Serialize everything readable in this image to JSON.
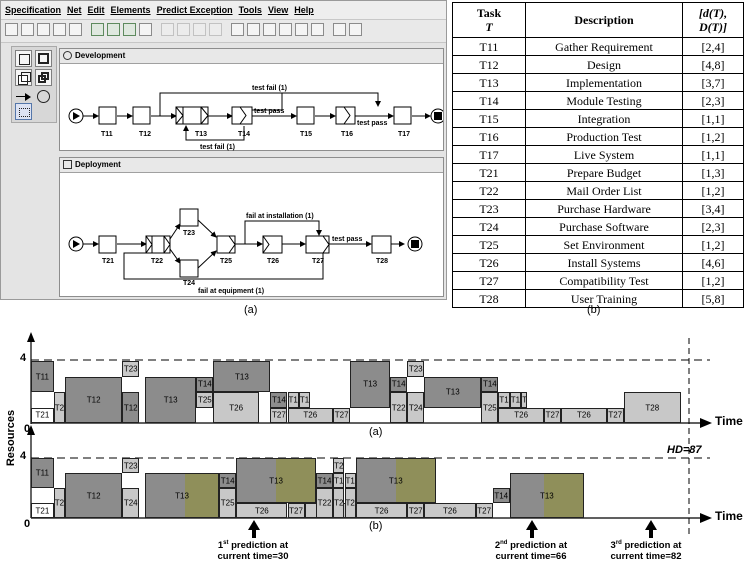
{
  "app": {
    "menus": [
      "Specification",
      "Net",
      "Edit",
      "Elements",
      "Predict Exception",
      "Tools",
      "View",
      "Help"
    ],
    "toolbar_icons": [
      "new-icon",
      "open-icon",
      "save-icon",
      "saveas-icon",
      "print-icon",
      "check-icon",
      "check-all-icon",
      "export-icon",
      "analyze-icon",
      "compare-icon",
      "redo-icon",
      "undo-icon",
      "delete-icon",
      "align-left-icon",
      "align-center-icon",
      "align-right-icon",
      "align-top-icon",
      "align-middle-icon",
      "align-bottom-icon",
      "zoom-icon",
      "fit-icon"
    ],
    "palette": [
      "atomic-task-icon",
      "composite-task-icon",
      "multi-task-icon",
      "composite-multi-task-icon",
      "flow-arrow-icon",
      "condition-icon",
      "marquee-icon"
    ],
    "panels": {
      "development": {
        "title": "Development",
        "tasks": [
          "T11",
          "T12",
          "T13",
          "T14",
          "T15",
          "T16",
          "T17"
        ],
        "edges": [
          "test fail (1)",
          "test pass",
          "test pass",
          "test fail (1)"
        ]
      },
      "deployment": {
        "title": "Deployment",
        "tasks": [
          "T21",
          "T22",
          "T23",
          "T24",
          "T25",
          "T26",
          "T27",
          "T28"
        ],
        "edges": [
          "fail at installation (1)",
          "test pass",
          "fail at equipment (1)"
        ]
      }
    }
  },
  "captions": {
    "a_top": "(a)",
    "b_top": "(b)",
    "a_chart": "(a)",
    "b_chart": "(b)"
  },
  "table": {
    "headers": {
      "task_lines": [
        "Task",
        "T"
      ],
      "description": "Description",
      "interval_lines": [
        "[d(T),",
        "D(T)]"
      ]
    },
    "rows": [
      {
        "task": "T11",
        "description": "Gather Requirement",
        "interval": "[2,4]"
      },
      {
        "task": "T12",
        "description": "Design",
        "interval": "[4,8]"
      },
      {
        "task": "T13",
        "description": "Implementation",
        "interval": "[3,7]"
      },
      {
        "task": "T14",
        "description": "Module Testing",
        "interval": "[2,3]"
      },
      {
        "task": "T15",
        "description": "Integration",
        "interval": "[1,1]"
      },
      {
        "task": "T16",
        "description": "Production Test",
        "interval": "[1,2]"
      },
      {
        "task": "T17",
        "description": "Live System",
        "interval": "[1,1]"
      },
      {
        "task": "T21",
        "description": "Prepare Budget",
        "interval": "[1,3]"
      },
      {
        "task": "T22",
        "description": "Mail Order List",
        "interval": "[1,2]"
      },
      {
        "task": "T23",
        "description": "Purchase Hardware",
        "interval": "[3,4]"
      },
      {
        "task": "T24",
        "description": "Purchase Software",
        "interval": "[2,3]"
      },
      {
        "task": "T25",
        "description": "Set Environment",
        "interval": "[1,2]"
      },
      {
        "task": "T26",
        "description": "Install Systems",
        "interval": "[4,6]"
      },
      {
        "task": "T27",
        "description": "Compatibility Test",
        "interval": "[1,2]"
      },
      {
        "task": "T28",
        "description": "User Training",
        "interval": "[5,8]"
      }
    ]
  },
  "chart": {
    "ylabel": "Resources",
    "xlabel": "Time",
    "y_tick_top": "4",
    "y_tick_zero": "0",
    "hd_label": "HD=87",
    "predictions": [
      {
        "ord": "1",
        "sup": "st",
        "text": " prediction at",
        "line2": "current time=30"
      },
      {
        "ord": "2",
        "sup": "nd",
        "text": " prediction at",
        "line2": "current time=66"
      },
      {
        "ord": "3",
        "sup": "rd",
        "text": " prediction at",
        "line2": "current time=82"
      }
    ]
  },
  "chart_data": [
    {
      "type": "gantt",
      "title": "(a)",
      "xlabel": "Time",
      "ylabel": "Resources",
      "ylim": [
        0,
        4
      ],
      "blocks": [
        {
          "task": "T11",
          "start": 0,
          "end": 4,
          "resources": [
            2,
            4
          ]
        },
        {
          "task": "T21",
          "start": 0,
          "end": 4,
          "resources": [
            0,
            1
          ]
        },
        {
          "task": "T22",
          "start": 4,
          "end": 6,
          "resources": [
            0,
            2
          ]
        },
        {
          "task": "T12",
          "start": 6,
          "end": 16,
          "resources": [
            0,
            3
          ]
        },
        {
          "task": "T23",
          "start": 16,
          "end": 19,
          "resources": [
            3,
            4
          ]
        },
        {
          "task": "T12",
          "start": 16,
          "end": 19,
          "resources": [
            0,
            2
          ]
        },
        {
          "task": "T13",
          "start": 20,
          "end": 29,
          "resources": [
            0,
            3
          ]
        },
        {
          "task": "T14",
          "start": 29,
          "end": 32,
          "resources": [
            2,
            3
          ]
        },
        {
          "task": "T25",
          "start": 29,
          "end": 32,
          "resources": [
            1,
            2
          ]
        },
        {
          "task": "T13",
          "start": 32,
          "end": 42,
          "resources": [
            2,
            4
          ]
        },
        {
          "task": "T26",
          "start": 32,
          "end": 40,
          "resources": [
            0,
            2
          ]
        },
        {
          "task": "T14",
          "start": 42,
          "end": 45,
          "resources": [
            1,
            2
          ]
        },
        {
          "task": "T15",
          "start": 45,
          "end": 47,
          "resources": [
            1,
            2
          ]
        },
        {
          "task": "T16",
          "start": 47,
          "end": 49,
          "resources": [
            1,
            2
          ]
        },
        {
          "task": "T27",
          "start": 42,
          "end": 45,
          "resources": [
            0,
            1
          ]
        },
        {
          "task": "T26",
          "start": 45,
          "end": 53,
          "resources": [
            0,
            1
          ]
        },
        {
          "task": "T27",
          "start": 53,
          "end": 56,
          "resources": [
            0,
            1
          ]
        },
        {
          "task": "T13",
          "start": 56,
          "end": 63,
          "resources": [
            1,
            4
          ]
        },
        {
          "task": "T14",
          "start": 63,
          "end": 66,
          "resources": [
            2,
            3
          ]
        },
        {
          "task": "T22",
          "start": 63,
          "end": 66,
          "resources": [
            0,
            2
          ]
        },
        {
          "task": "T23",
          "start": 66,
          "end": 69,
          "resources": [
            3,
            4
          ]
        },
        {
          "task": "T24",
          "start": 66,
          "end": 69,
          "resources": [
            0,
            2
          ]
        },
        {
          "task": "T13",
          "start": 69,
          "end": 79,
          "resources": [
            1,
            3
          ]
        },
        {
          "task": "T14",
          "start": 79,
          "end": 82,
          "resources": [
            2,
            3
          ]
        },
        {
          "task": "T25",
          "start": 79,
          "end": 82,
          "resources": [
            0,
            2
          ]
        },
        {
          "task": "T15",
          "start": 82,
          "end": 84,
          "resources": [
            1,
            2
          ]
        },
        {
          "task": "T16",
          "start": 84,
          "end": 86,
          "resources": [
            1,
            2
          ]
        },
        {
          "task": "T17",
          "start": 86,
          "end": 87,
          "resources": [
            1,
            2
          ]
        },
        {
          "task": "T26",
          "start": 82,
          "end": 90,
          "resources": [
            0,
            1
          ]
        },
        {
          "task": "T27",
          "start": 90,
          "end": 93,
          "resources": [
            0,
            1
          ]
        },
        {
          "task": "T26",
          "start": 93,
          "end": 101,
          "resources": [
            0,
            1
          ]
        },
        {
          "task": "T27",
          "start": 101,
          "end": 104,
          "resources": [
            0,
            1
          ]
        },
        {
          "task": "T28",
          "start": 104,
          "end": 114,
          "resources": [
            0,
            2
          ]
        }
      ]
    },
    {
      "type": "gantt",
      "title": "(b)",
      "xlabel": "Time",
      "ylabel": "Resources",
      "ylim": [
        0,
        4
      ],
      "deadline_label": "HD=87",
      "blocks": [
        {
          "task": "T11",
          "start": 0,
          "end": 4,
          "resources": [
            2,
            4
          ]
        },
        {
          "task": "T21",
          "start": 0,
          "end": 4,
          "resources": [
            0,
            1
          ]
        },
        {
          "task": "T22",
          "start": 4,
          "end": 6,
          "resources": [
            0,
            2
          ]
        },
        {
          "task": "T12",
          "start": 6,
          "end": 16,
          "resources": [
            0,
            3
          ]
        },
        {
          "task": "T23",
          "start": 16,
          "end": 19,
          "resources": [
            3,
            4
          ]
        },
        {
          "task": "T24",
          "start": 16,
          "end": 19,
          "resources": [
            0,
            2
          ]
        },
        {
          "task": "T13",
          "start": 20,
          "end": 33,
          "resources": [
            0,
            3
          ],
          "predicted_from": 27
        },
        {
          "task": "T14",
          "start": 33,
          "end": 36,
          "resources": [
            2,
            3
          ]
        },
        {
          "task": "T25",
          "start": 33,
          "end": 36,
          "resources": [
            0,
            2
          ]
        },
        {
          "task": "T13",
          "start": 36,
          "end": 50,
          "resources": [
            1,
            4
          ],
          "predicted_from": 43
        },
        {
          "task": "T26",
          "start": 36,
          "end": 45,
          "resources": [
            0,
            1
          ]
        },
        {
          "task": "T27",
          "start": 45,
          "end": 48,
          "resources": [
            0,
            1
          ]
        },
        {
          "task": "T26",
          "start": 48,
          "end": 57,
          "resources": [
            0,
            1
          ]
        },
        {
          "task": "T27",
          "start": 57,
          "end": 60,
          "resources": [
            0,
            1
          ]
        },
        {
          "task": "T14",
          "start": 50,
          "end": 53,
          "resources": [
            2,
            3
          ]
        },
        {
          "task": "T22",
          "start": 50,
          "end": 53,
          "resources": [
            0,
            2
          ]
        },
        {
          "task": "T23",
          "start": 53,
          "end": 55,
          "resources": [
            3,
            4
          ]
        },
        {
          "task": "T15",
          "start": 53,
          "end": 55,
          "resources": [
            2,
            3
          ]
        },
        {
          "task": "T24",
          "start": 53,
          "end": 55,
          "resources": [
            0,
            2
          ]
        },
        {
          "task": "T16",
          "start": 55,
          "end": 57,
          "resources": [
            2,
            3
          ]
        },
        {
          "task": "T25",
          "start": 55,
          "end": 57,
          "resources": [
            0,
            2
          ]
        },
        {
          "task": "T13",
          "start": 57,
          "end": 71,
          "resources": [
            1,
            4
          ],
          "predicted_from": 64
        },
        {
          "task": "T26",
          "start": 57,
          "end": 66,
          "resources": [
            0,
            1
          ]
        },
        {
          "task": "T27",
          "start": 66,
          "end": 69,
          "resources": [
            0,
            1
          ]
        },
        {
          "task": "T26",
          "start": 69,
          "end": 78,
          "resources": [
            0,
            1
          ]
        },
        {
          "task": "T27",
          "start": 78,
          "end": 81,
          "resources": [
            0,
            1
          ]
        },
        {
          "task": "T14",
          "start": 81,
          "end": 84,
          "resources": [
            1,
            2
          ]
        },
        {
          "task": "T13",
          "start": 84,
          "end": 97,
          "resources": [
            0,
            3
          ],
          "predicted_from": 90
        }
      ]
    }
  ],
  "colors": {
    "dark": "#8c8c8c",
    "light": "#c8c8c8",
    "white": "#ffffff",
    "pred": "#8f8f5a"
  }
}
